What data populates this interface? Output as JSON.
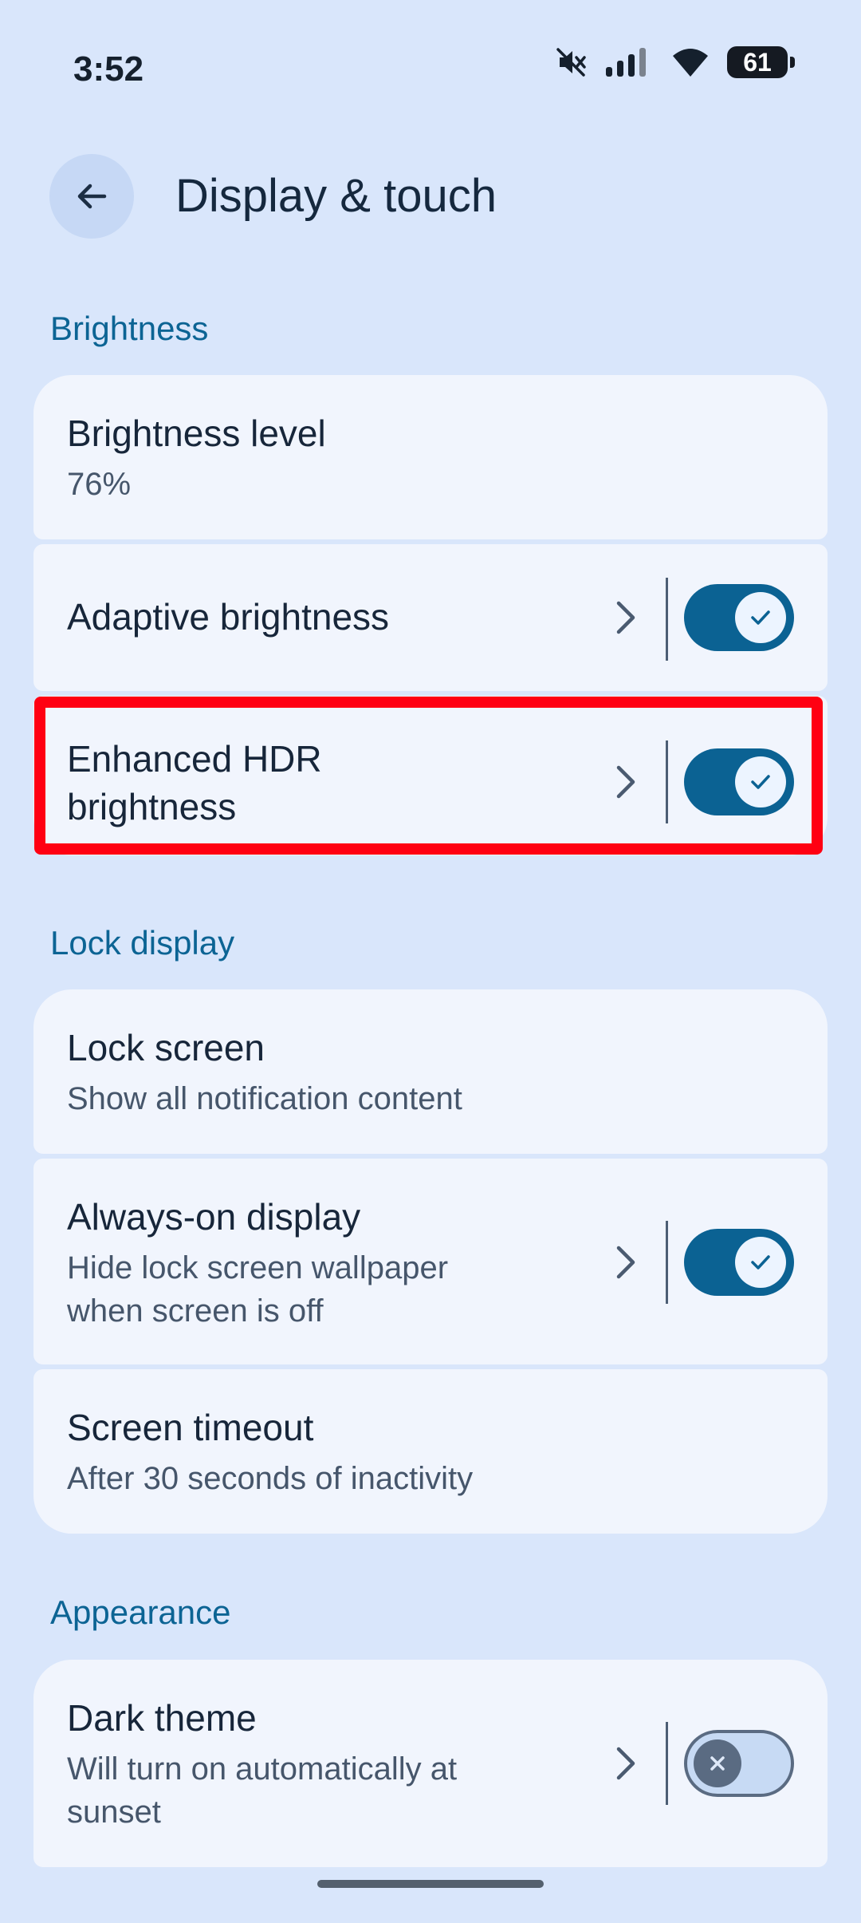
{
  "status_bar": {
    "time": "3:52",
    "battery": "61",
    "icons": [
      "mute-icon",
      "signal-icon",
      "wifi-icon",
      "battery-icon"
    ]
  },
  "header": {
    "title": "Display & touch",
    "back_icon": "arrow-left-icon"
  },
  "sections": {
    "brightness": {
      "header": "Brightness",
      "brightness_level": {
        "title": "Brightness level",
        "value": "76%"
      },
      "adaptive_brightness": {
        "title": "Adaptive brightness",
        "toggle_on": true
      },
      "enhanced_hdr": {
        "title_line1": "Enhanced HDR",
        "title_line2": "brightness",
        "toggle_on": true
      }
    },
    "lock_display": {
      "header": "Lock display",
      "lock_screen": {
        "title": "Lock screen",
        "subtitle": "Show all notification content"
      },
      "always_on": {
        "title": "Always-on display",
        "subtitle_line1": "Hide lock screen wallpaper",
        "subtitle_line2": "when screen is off",
        "toggle_on": true
      },
      "screen_timeout": {
        "title": "Screen timeout",
        "subtitle": "After 30 seconds of inactivity"
      }
    },
    "appearance": {
      "header": "Appearance",
      "dark_theme": {
        "title": "Dark theme",
        "subtitle_line1": "Will turn on automatically at",
        "subtitle_line2": "sunset",
        "toggle_on": false
      }
    }
  },
  "colors": {
    "background": "#d9e6fb",
    "card": "#f1f5fd",
    "accent": "#0b6293",
    "section_header": "#0c6494",
    "highlight": "#ff0012"
  }
}
